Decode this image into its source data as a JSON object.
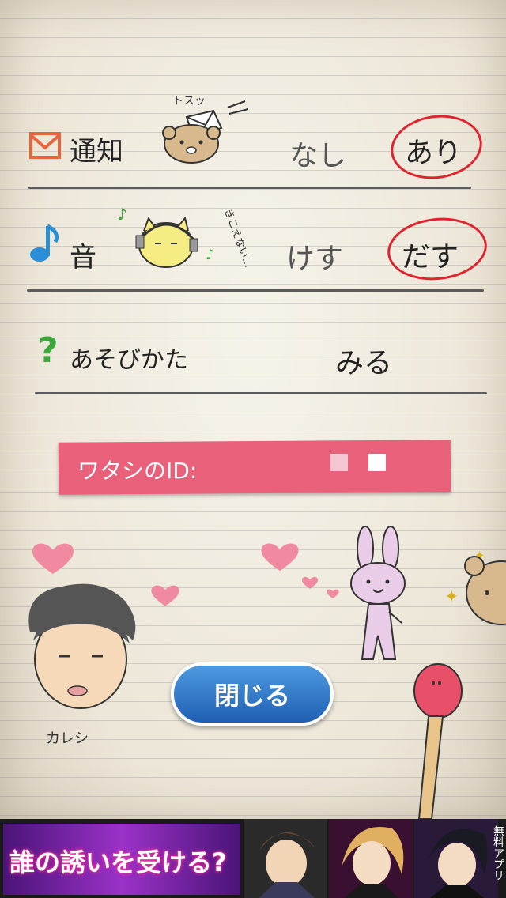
{
  "settings": {
    "notification": {
      "label": "通知",
      "off": "なし",
      "on": "あり",
      "sketch_note": "トスッ"
    },
    "sound": {
      "label": "音",
      "off": "けす",
      "on": "だす",
      "sketch_note": "きこえない…"
    },
    "howto": {
      "label": "あそびかた",
      "action": "みる"
    }
  },
  "id_bar": {
    "label": "ワタシのID:"
  },
  "close_button": {
    "label": "閉じる"
  },
  "doodles": {
    "boyfriend_caption": "カレシ"
  },
  "ad": {
    "headline": "誰の誘いを受ける?",
    "free_app": "無料アプリ"
  },
  "colors": {
    "accent_red": "#e0242e",
    "id_bar": "#e8607a",
    "button_blue": "#2a6fc2",
    "mail_orange": "#e8643c",
    "note_blue": "#2a8fd6",
    "question_green": "#3aa83a"
  },
  "icons": [
    "mail-icon",
    "music-note-icon",
    "question-icon",
    "bear-doodle-icon",
    "cat-headphone-doodle-icon",
    "rabbit-doodle-icon",
    "heart-icon"
  ]
}
